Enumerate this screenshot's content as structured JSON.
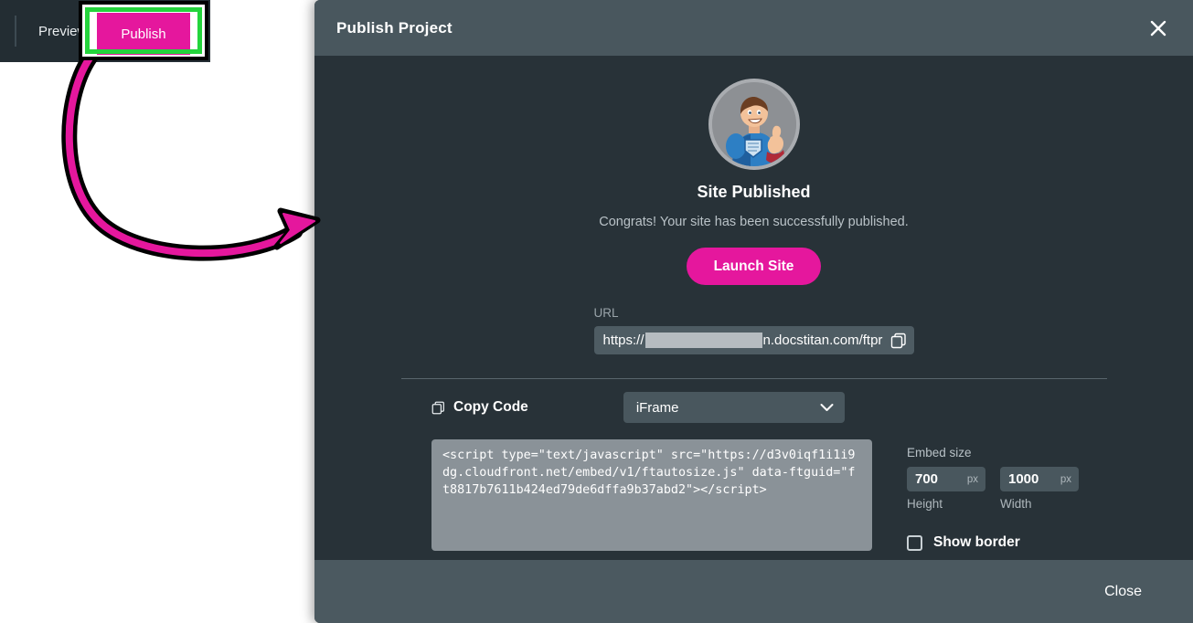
{
  "app_toolbar": {
    "preview_label": "Preview",
    "publish_label": "Publish",
    "publish_color": "#e5179d",
    "highlight_color": "#24d43c"
  },
  "annotation": {
    "arrow_color": "#e5179d",
    "arrow_outline_color": "#000000",
    "type": "curved-arrow"
  },
  "dialog": {
    "title": "Publish Project",
    "close_icon": "close-icon",
    "header_color": "#49575e",
    "body_color": "#283238",
    "mascot": {
      "icon": "superhero-thumbs-up-avatar",
      "alt": "Site Titan superhero mascot giving a thumbs up"
    },
    "status_title": "Site Published",
    "status_message": "Congrats! Your site has been successfully published.",
    "launch_button": {
      "label": "Launch Site",
      "color": "#e5179d"
    },
    "url": {
      "label": "URL",
      "prefix": "https://",
      "redacted": true,
      "suffix": "n.docstitan.com/ftpr",
      "copy_icon": "copy-icon"
    },
    "copy_code": {
      "label": "Copy Code",
      "icon": "copy-icon",
      "embed_type": "iFrame",
      "dropdown_icon": "chevron-down-icon",
      "snippet": "<script type=\"text/javascript\" src=\"https://d3v0iqf1i1i9dg.cloudfront.net/embed/v1/ftautosize.js\" data-ftguid=\"ft8817b7611b424ed79de6dffa9b37abd2\"></script>"
    },
    "embed_size": {
      "title": "Embed size",
      "height_value": "700",
      "height_unit": "px",
      "height_caption": "Height",
      "width_value": "1000",
      "width_unit": "px",
      "width_caption": "Width"
    },
    "show_border": {
      "label": "Show border",
      "checked": false
    },
    "footer": {
      "close_label": "Close"
    }
  }
}
